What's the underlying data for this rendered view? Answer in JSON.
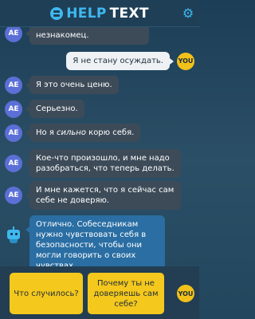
{
  "header": {
    "logo_help": "HELP",
    "logo_text": "TEXT",
    "settings_icon": "gear-icon"
  },
  "messages": [
    {
      "sender": "AE",
      "text": "незнакомец."
    },
    {
      "sender": "YOU",
      "text": "Я не стану осуждать."
    },
    {
      "sender": "AE",
      "text": "Я это очень ценю."
    },
    {
      "sender": "AE",
      "text": "Серьезно."
    },
    {
      "sender": "AE",
      "text_before": "Но я ",
      "text_em": "сильно",
      "text_after": " корю себя."
    },
    {
      "sender": "AE",
      "text": "Кое-что произошло, и мне надо разобраться, что теперь делать."
    },
    {
      "sender": "AE",
      "text": "И мне кажется, что я сейчас сам себе не доверяю."
    },
    {
      "sender": "bot",
      "text": "Отлично. Собеседникам нужно чувствовать себя в безопасности, чтобы они могли говорить о своих чувствах."
    }
  ],
  "labels": {
    "ae": "AE",
    "you": "YOU"
  },
  "choices": [
    {
      "text": "Что случилось?"
    },
    {
      "text": "Почему ты не доверяешь сам себе?"
    }
  ],
  "colors": {
    "accent": "#3fb8f0",
    "choice": "#f4c81c",
    "bot_bubble": "#2a6ea3",
    "ae_avatar": "#5b6fd6"
  }
}
